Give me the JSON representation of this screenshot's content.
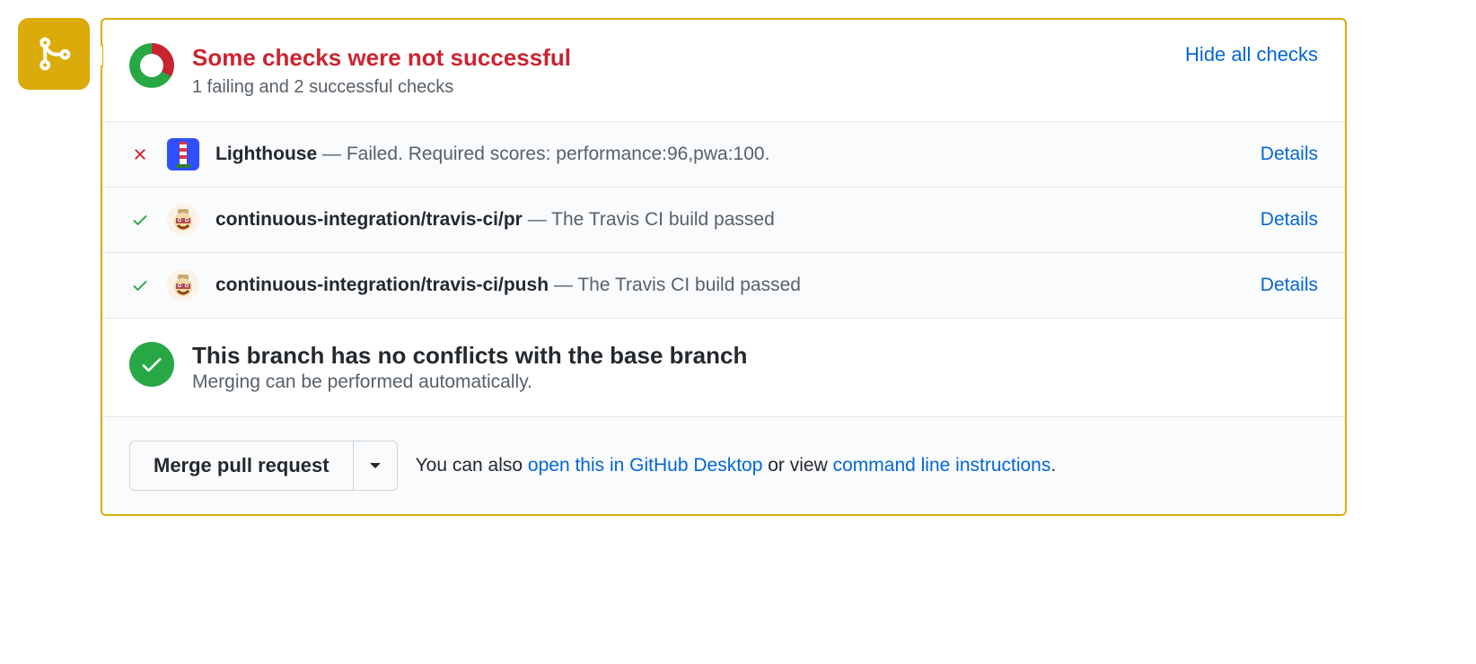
{
  "header": {
    "title": "Some checks were not successful",
    "subtitle": "1 failing and 2 successful checks",
    "hide_link": "Hide all checks"
  },
  "checks": [
    {
      "status": "fail",
      "name": "Lighthouse",
      "message": " — Failed. Required scores: performance:96,pwa:100.",
      "details": "Details",
      "avatar": "lighthouse"
    },
    {
      "status": "pass",
      "name": "continuous-integration/travis-ci/pr",
      "message": " — The Travis CI build passed",
      "details": "Details",
      "avatar": "travis"
    },
    {
      "status": "pass",
      "name": "continuous-integration/travis-ci/push",
      "message": " — The Travis CI build passed",
      "details": "Details",
      "avatar": "travis"
    }
  ],
  "conflict": {
    "title": "This branch has no conflicts with the base branch",
    "subtitle": "Merging can be performed automatically."
  },
  "merge": {
    "button": "Merge pull request",
    "info_prefix": "You can also ",
    "link_desktop": "open this in GitHub Desktop",
    "info_middle": " or view ",
    "link_cli": "command line instructions",
    "info_suffix": "."
  }
}
